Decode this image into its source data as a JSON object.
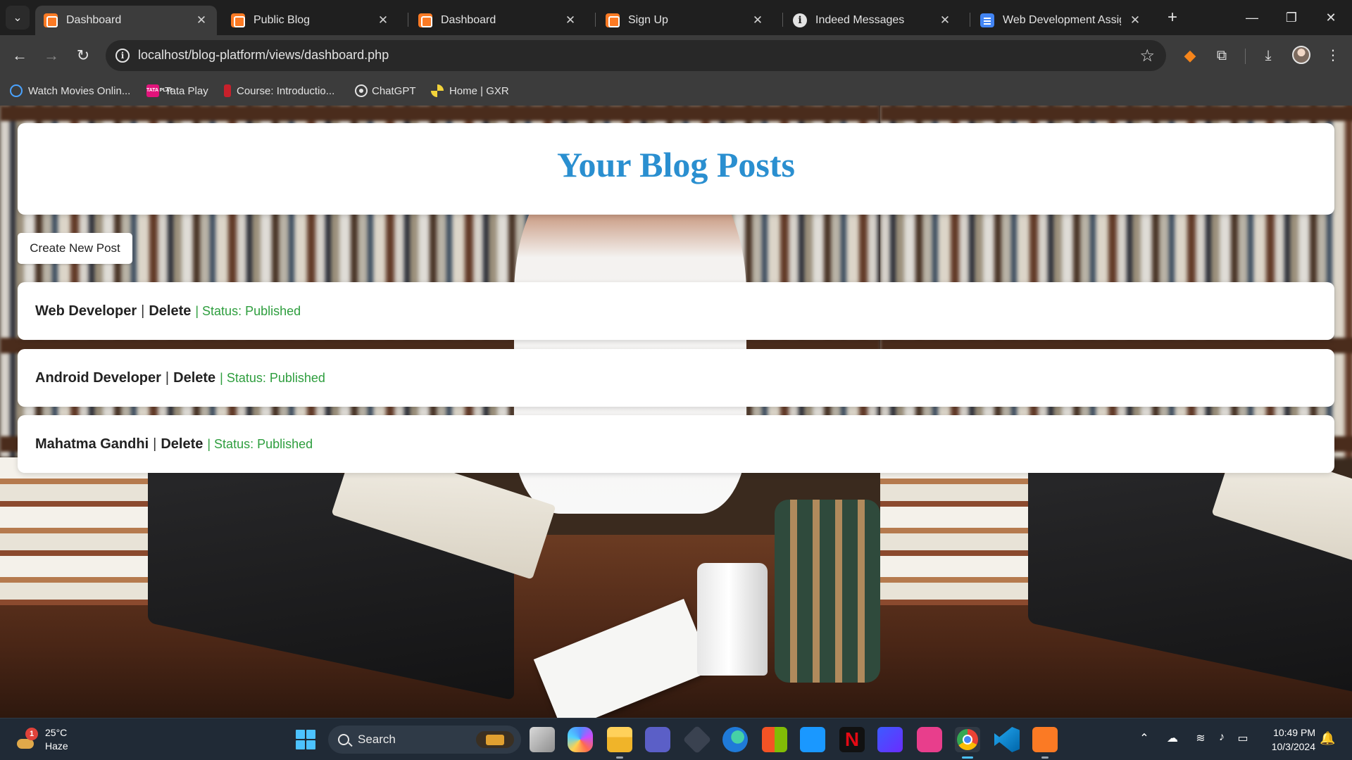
{
  "browser": {
    "tabs": [
      {
        "title": "Dashboard",
        "favicon": "xampp-icon",
        "active": true
      },
      {
        "title": "Public Blog",
        "favicon": "xampp-icon",
        "active": false
      },
      {
        "title": "Dashboard",
        "favicon": "xampp-icon",
        "active": false
      },
      {
        "title": "Sign Up",
        "favicon": "xampp-icon",
        "active": false
      },
      {
        "title": "Indeed Messages",
        "favicon": "info-icon",
        "active": false
      },
      {
        "title": "Web Development Assignm",
        "favicon": "google-docs-icon",
        "active": false
      }
    ],
    "tab_close_glyph": "✕",
    "new_tab_glyph": "+",
    "url": "localhost/blog-platform/views/dashboard.php",
    "bookmarks": [
      {
        "label": "Watch Movies Onlin...",
        "icon": "movie-icon"
      },
      {
        "label": "Tata Play",
        "icon": "tata-play-icon",
        "icon_text": "TATA PLAY"
      },
      {
        "label": "Course: Introductio...",
        "icon": "course-icon"
      },
      {
        "label": "ChatGPT",
        "icon": "chatgpt-icon"
      },
      {
        "label": "Home | GXR",
        "icon": "gxr-icon"
      }
    ]
  },
  "page": {
    "title": "Your Blog Posts",
    "create_button": "Create New Post",
    "separator": "|",
    "posts": [
      {
        "title": "Web Developer",
        "delete_label": "Delete",
        "status": "| Status: Published"
      },
      {
        "title": "Android Developer",
        "delete_label": "Delete",
        "status": "| Status: Published"
      },
      {
        "title": "Mahatma Gandhi",
        "delete_label": "Delete",
        "status": "| Status: Published"
      }
    ]
  },
  "taskbar": {
    "weather": {
      "temp": "25°C",
      "condition": "Haze",
      "badge": "1"
    },
    "search_placeholder": "Search",
    "time": "10:49 PM",
    "date": "10/3/2024"
  },
  "colors": {
    "title_blue": "#2a8fd0",
    "status_green": "#2e9e3e",
    "chrome_dark": "#1f1f1f",
    "chrome_toolbar": "#3c3c3c",
    "taskbar": "#202a36"
  }
}
